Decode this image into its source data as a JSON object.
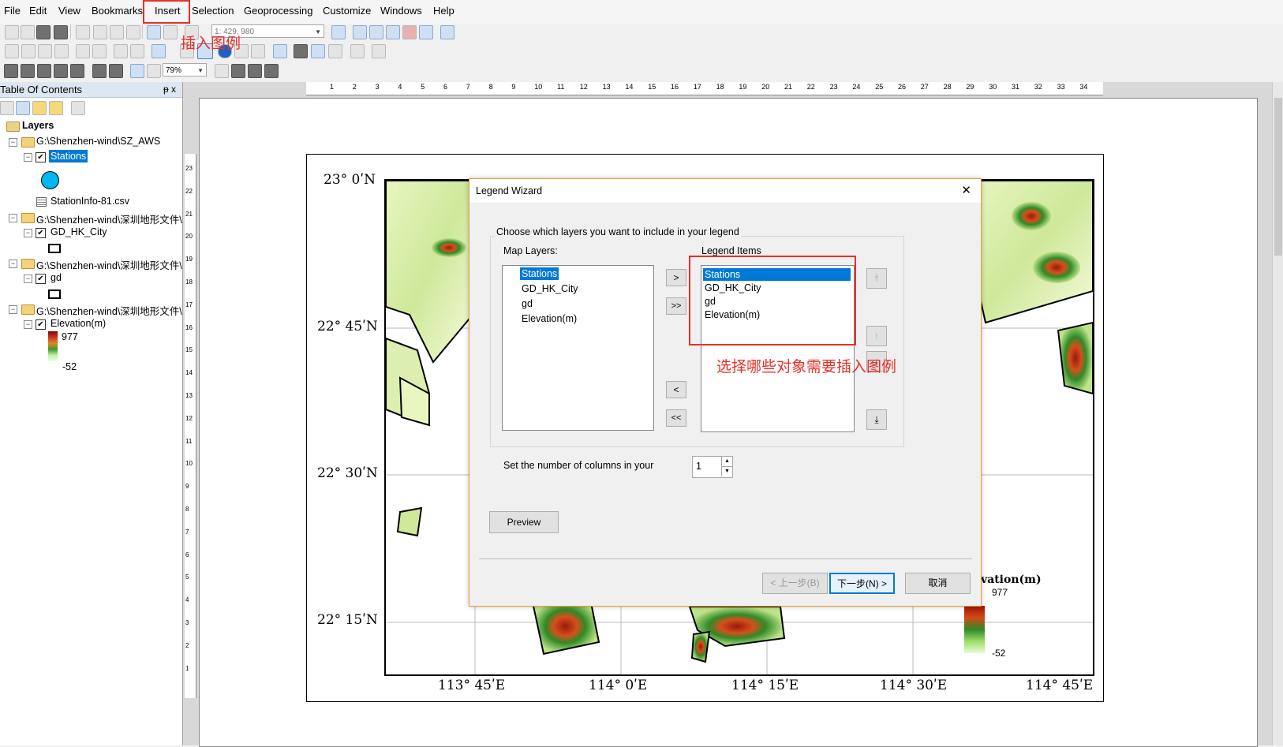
{
  "menubar": {
    "items": [
      "File",
      "Edit",
      "View",
      "Bookmarks",
      "Insert",
      "Selection",
      "Geoprocessing",
      "Customize",
      "Windows",
      "Help"
    ],
    "highlighted": "Insert"
  },
  "toolbar": {
    "scale": "1: 429, 980",
    "zoom": "79%"
  },
  "annotations": {
    "insert_legend": "插入图例",
    "choose_objects": "选择哪些对象需要插入图例",
    "color": "#e8302a"
  },
  "toc": {
    "title": "Table Of Contents",
    "pin": "ᵽ x",
    "root": "Layers",
    "groups": [
      {
        "path": "G:\\Shenzhen-wind\\SZ_AWS",
        "layer": "Stations",
        "extra": "StationInfo-81.csv"
      },
      {
        "path": "G:\\Shenzhen-wind\\深圳地形文件\\",
        "layer": "GD_HK_City"
      },
      {
        "path": "G:\\Shenzhen-wind\\深圳地形文件\\",
        "layer": "gd"
      },
      {
        "path": "G:\\Shenzhen-wind\\深圳地形文件\\",
        "layer": "Elevation(m)",
        "max": "977",
        "min": "-52"
      }
    ],
    "station_symbol_color": "#00b8ee"
  },
  "ruler": {
    "top_ticks": [
      "1",
      "2",
      "3",
      "4",
      "5",
      "6",
      "7",
      "8",
      "9",
      "10",
      "11",
      "12",
      "13",
      "14",
      "15",
      "16",
      "17",
      "18",
      "19",
      "20",
      "21",
      "22",
      "23",
      "24",
      "25",
      "26",
      "27",
      "28",
      "29",
      "30",
      "31",
      "32",
      "33",
      "34"
    ],
    "left_ticks": [
      "23",
      "22",
      "21",
      "20",
      "19",
      "18",
      "17",
      "16",
      "15",
      "14",
      "13",
      "12",
      "11",
      "10",
      "9",
      "8",
      "7",
      "6",
      "5",
      "4",
      "3",
      "2",
      "1"
    ]
  },
  "map": {
    "lat_labels": [
      "23°  0ʹN",
      "22°  45ʹN",
      "22°  30ʹN",
      "22°  15ʹN"
    ],
    "lon_labels": [
      "113°  45ʹE",
      "114°  0ʹE",
      "114°  15ʹE",
      "114°  30ʹE",
      "114°  45ʹE"
    ],
    "legend_title": "vation(m)",
    "legend_max": "977",
    "legend_min": "-52"
  },
  "dialog": {
    "title": "Legend Wizard",
    "close": "✕",
    "group_label": "Choose which layers you want to include in your legend",
    "map_layers_label": "Map Layers:",
    "legend_items_label": "Legend Items",
    "map_layers": [
      "Stations",
      "GD_HK_City",
      "gd",
      "Elevation(m)"
    ],
    "legend_items": [
      "Stations",
      "GD_HK_City",
      "gd",
      "Elevation(m)"
    ],
    "add_one": ">",
    "add_all": ">>",
    "remove_one": "<",
    "remove_all": "<<",
    "columns_label": "Set the number of columns in your",
    "columns_value": "1",
    "preview": "Preview",
    "back": "< 上一步(B)",
    "next": "下一步(N) >",
    "cancel": "取消"
  }
}
